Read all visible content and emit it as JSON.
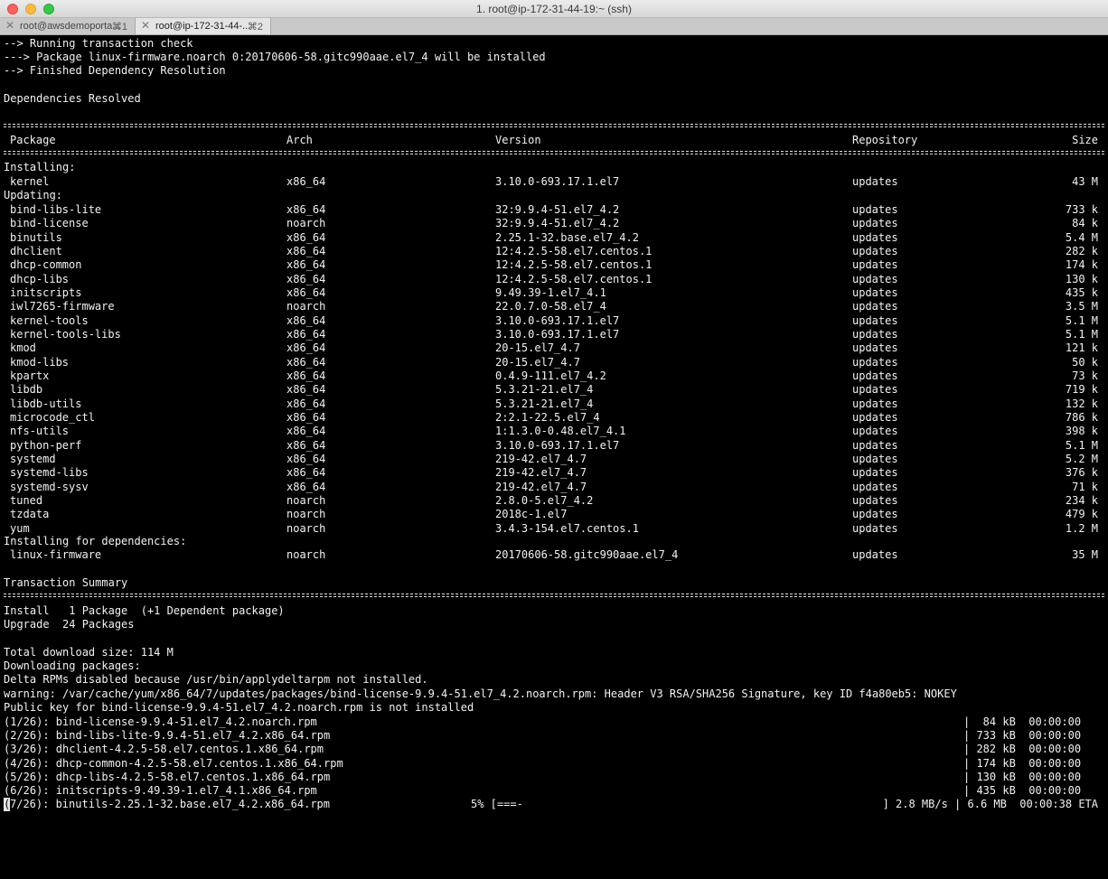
{
  "window": {
    "title": "1. root@ip-172-31-44-19:~ (ssh)"
  },
  "tabs": [
    {
      "label": "root@awsdemoporta...",
      "shortcut": "⌘1"
    },
    {
      "label": "root@ip-172-31-44-...",
      "shortcut": "⌘2"
    }
  ],
  "header_lines": [
    "--> Running transaction check",
    "---> Package linux-firmware.noarch 0:20170606-58.gitc990aae.el7_4 will be installed",
    "--> Finished Dependency Resolution",
    "Dependencies Resolved"
  ],
  "table": {
    "headers": {
      "package": "Package",
      "arch": "Arch",
      "version": "Version",
      "repository": "Repository",
      "size": "Size"
    },
    "sections": {
      "installing": "Installing:",
      "updating": "Updating:",
      "deps": "Installing for dependencies:"
    },
    "installing": [
      {
        "name": "kernel",
        "arch": "x86_64",
        "version": "3.10.0-693.17.1.el7",
        "repo": "updates",
        "size": "43 M"
      }
    ],
    "updating": [
      {
        "name": "bind-libs-lite",
        "arch": "x86_64",
        "version": "32:9.9.4-51.el7_4.2",
        "repo": "updates",
        "size": "733 k"
      },
      {
        "name": "bind-license",
        "arch": "noarch",
        "version": "32:9.9.4-51.el7_4.2",
        "repo": "updates",
        "size": "84 k"
      },
      {
        "name": "binutils",
        "arch": "x86_64",
        "version": "2.25.1-32.base.el7_4.2",
        "repo": "updates",
        "size": "5.4 M"
      },
      {
        "name": "dhclient",
        "arch": "x86_64",
        "version": "12:4.2.5-58.el7.centos.1",
        "repo": "updates",
        "size": "282 k"
      },
      {
        "name": "dhcp-common",
        "arch": "x86_64",
        "version": "12:4.2.5-58.el7.centos.1",
        "repo": "updates",
        "size": "174 k"
      },
      {
        "name": "dhcp-libs",
        "arch": "x86_64",
        "version": "12:4.2.5-58.el7.centos.1",
        "repo": "updates",
        "size": "130 k"
      },
      {
        "name": "initscripts",
        "arch": "x86_64",
        "version": "9.49.39-1.el7_4.1",
        "repo": "updates",
        "size": "435 k"
      },
      {
        "name": "iwl7265-firmware",
        "arch": "noarch",
        "version": "22.0.7.0-58.el7_4",
        "repo": "updates",
        "size": "3.5 M"
      },
      {
        "name": "kernel-tools",
        "arch": "x86_64",
        "version": "3.10.0-693.17.1.el7",
        "repo": "updates",
        "size": "5.1 M"
      },
      {
        "name": "kernel-tools-libs",
        "arch": "x86_64",
        "version": "3.10.0-693.17.1.el7",
        "repo": "updates",
        "size": "5.1 M"
      },
      {
        "name": "kmod",
        "arch": "x86_64",
        "version": "20-15.el7_4.7",
        "repo": "updates",
        "size": "121 k"
      },
      {
        "name": "kmod-libs",
        "arch": "x86_64",
        "version": "20-15.el7_4.7",
        "repo": "updates",
        "size": "50 k"
      },
      {
        "name": "kpartx",
        "arch": "x86_64",
        "version": "0.4.9-111.el7_4.2",
        "repo": "updates",
        "size": "73 k"
      },
      {
        "name": "libdb",
        "arch": "x86_64",
        "version": "5.3.21-21.el7_4",
        "repo": "updates",
        "size": "719 k"
      },
      {
        "name": "libdb-utils",
        "arch": "x86_64",
        "version": "5.3.21-21.el7_4",
        "repo": "updates",
        "size": "132 k"
      },
      {
        "name": "microcode_ctl",
        "arch": "x86_64",
        "version": "2:2.1-22.5.el7_4",
        "repo": "updates",
        "size": "786 k"
      },
      {
        "name": "nfs-utils",
        "arch": "x86_64",
        "version": "1:1.3.0-0.48.el7_4.1",
        "repo": "updates",
        "size": "398 k"
      },
      {
        "name": "python-perf",
        "arch": "x86_64",
        "version": "3.10.0-693.17.1.el7",
        "repo": "updates",
        "size": "5.1 M"
      },
      {
        "name": "systemd",
        "arch": "x86_64",
        "version": "219-42.el7_4.7",
        "repo": "updates",
        "size": "5.2 M"
      },
      {
        "name": "systemd-libs",
        "arch": "x86_64",
        "version": "219-42.el7_4.7",
        "repo": "updates",
        "size": "376 k"
      },
      {
        "name": "systemd-sysv",
        "arch": "x86_64",
        "version": "219-42.el7_4.7",
        "repo": "updates",
        "size": "71 k"
      },
      {
        "name": "tuned",
        "arch": "noarch",
        "version": "2.8.0-5.el7_4.2",
        "repo": "updates",
        "size": "234 k"
      },
      {
        "name": "tzdata",
        "arch": "noarch",
        "version": "2018c-1.el7",
        "repo": "updates",
        "size": "479 k"
      },
      {
        "name": "yum",
        "arch": "noarch",
        "version": "3.4.3-154.el7.centos.1",
        "repo": "updates",
        "size": "1.2 M"
      }
    ],
    "deps": [
      {
        "name": "linux-firmware",
        "arch": "noarch",
        "version": "20170606-58.gitc990aae.el7_4",
        "repo": "updates",
        "size": "35 M"
      }
    ]
  },
  "summary": {
    "title": "Transaction Summary",
    "install_line": "Install   1 Package  (+1 Dependent package)",
    "upgrade_line": "Upgrade  24 Packages"
  },
  "download_lines": [
    "Total download size: 114 M",
    "Downloading packages:",
    "Delta RPMs disabled because /usr/bin/applydeltarpm not installed.",
    "warning: /var/cache/yum/x86_64/7/updates/packages/bind-license-9.9.4-51.el7_4.2.noarch.rpm: Header V3 RSA/SHA256 Signature, key ID f4a80eb5: NOKEY",
    "Public key for bind-license-9.9.4-51.el7_4.2.noarch.rpm is not installed"
  ],
  "downloads": [
    {
      "file": "(1/26): bind-license-9.9.4-51.el7_4.2.noarch.rpm",
      "stat": "|  84 kB  00:00:00"
    },
    {
      "file": "(2/26): bind-libs-lite-9.9.4-51.el7_4.2.x86_64.rpm",
      "stat": "| 733 kB  00:00:00"
    },
    {
      "file": "(3/26): dhclient-4.2.5-58.el7.centos.1.x86_64.rpm",
      "stat": "| 282 kB  00:00:00"
    },
    {
      "file": "(4/26): dhcp-common-4.2.5-58.el7.centos.1.x86_64.rpm",
      "stat": "| 174 kB  00:00:00"
    },
    {
      "file": "(5/26): dhcp-libs-4.2.5-58.el7.centos.1.x86_64.rpm",
      "stat": "| 130 kB  00:00:00"
    },
    {
      "file": "(6/26): initscripts-9.49.39-1.el7_4.1.x86_64.rpm",
      "stat": "| 435 kB  00:00:00"
    }
  ],
  "progress": {
    "cursor_char": "(",
    "file": "7/26): binutils-2.25.1-32.base.el7_4.2.x86_64.rpm",
    "percent": "5% [===-",
    "stat": "] 2.8 MB/s | 6.6 MB  00:00:38 ETA"
  }
}
